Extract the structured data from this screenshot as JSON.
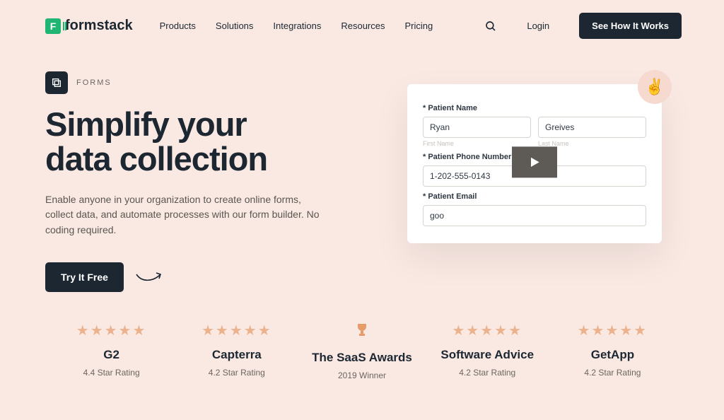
{
  "nav": {
    "brand": "formstack",
    "links": [
      "Products",
      "Solutions",
      "Integrations",
      "Resources",
      "Pricing"
    ],
    "login": "Login",
    "cta": "See How It Works"
  },
  "hero": {
    "product_tag": "FORMS",
    "headline_line1": "Simplify your",
    "headline_line2": "data collection",
    "subhead": "Enable anyone in your organization to create online forms, collect data, and automate processes with our form builder. No coding required.",
    "try": "Try It Free"
  },
  "form_card": {
    "label_name": "Patient Name",
    "first_value": "Ryan",
    "last_value": "Greives",
    "hint_first": "First Name",
    "hint_last": "Last Name",
    "label_phone": "Patient Phone Number",
    "phone_value": "1-202-555-0143",
    "label_email": "Patient Email",
    "email_value": "goo"
  },
  "ratings": [
    {
      "name": "G2",
      "sub": "4.4 Star Rating",
      "type": "stars"
    },
    {
      "name": "Capterra",
      "sub": "4.2 Star Rating",
      "type": "stars"
    },
    {
      "name": "The SaaS Awards",
      "sub": "2019 Winner",
      "type": "trophy"
    },
    {
      "name": "Software Advice",
      "sub": "4.2 Star Rating",
      "type": "stars"
    },
    {
      "name": "GetApp",
      "sub": "4.2 Star Rating",
      "type": "stars"
    }
  ]
}
